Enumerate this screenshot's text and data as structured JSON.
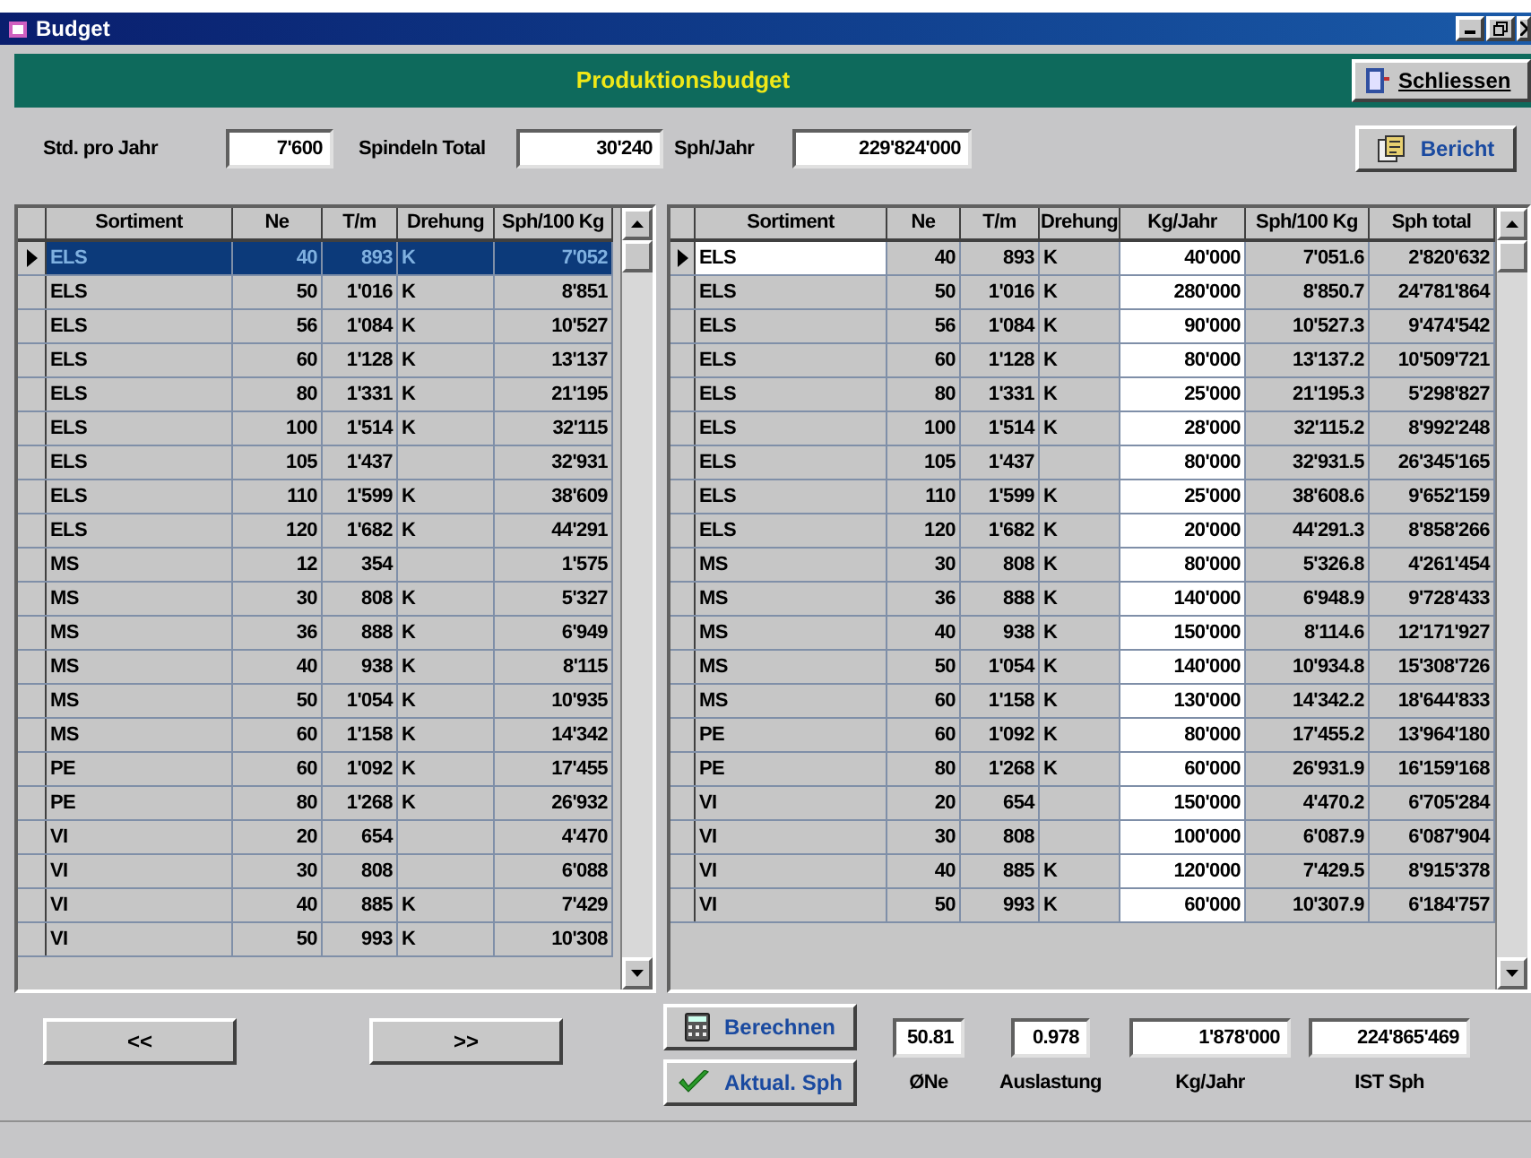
{
  "window": {
    "title": "Budget"
  },
  "header": {
    "title": "Produktionsbudget",
    "close_button": "Schliessen"
  },
  "fields": [
    {
      "label": "Std. pro Jahr",
      "value": "7'600"
    },
    {
      "label": "Spindeln Total",
      "value": "30'240"
    },
    {
      "label": "Sph/Jahr",
      "value": "229'824'000"
    }
  ],
  "report_button": "Bericht",
  "left_table": {
    "kind": "highlight",
    "columns": [
      {
        "label": "Sortiment",
        "kind": "text"
      },
      {
        "label": "Ne",
        "kind": "text"
      },
      {
        "label": "T/m",
        "kind": "text"
      },
      {
        "label": "Drehung",
        "kind": "text"
      },
      {
        "label": "Sph/100 Kg",
        "kind": "text"
      }
    ],
    "rows": [
      {
        "selected": true,
        "cells": [
          "ELS",
          "40",
          "893",
          "K",
          "7'052"
        ]
      },
      {
        "selected": false,
        "cells": [
          "ELS",
          "50",
          "1'016",
          "K",
          "8'851"
        ]
      },
      {
        "selected": false,
        "cells": [
          "ELS",
          "56",
          "1'084",
          "K",
          "10'527"
        ]
      },
      {
        "selected": false,
        "cells": [
          "ELS",
          "60",
          "1'128",
          "K",
          "13'137"
        ]
      },
      {
        "selected": false,
        "cells": [
          "ELS",
          "80",
          "1'331",
          "K",
          "21'195"
        ]
      },
      {
        "selected": false,
        "cells": [
          "ELS",
          "100",
          "1'514",
          "K",
          "32'115"
        ]
      },
      {
        "selected": false,
        "cells": [
          "ELS",
          "105",
          "1'437",
          "",
          "32'931"
        ]
      },
      {
        "selected": false,
        "cells": [
          "ELS",
          "110",
          "1'599",
          "K",
          "38'609"
        ]
      },
      {
        "selected": false,
        "cells": [
          "ELS",
          "120",
          "1'682",
          "K",
          "44'291"
        ]
      },
      {
        "selected": false,
        "cells": [
          "MS",
          "12",
          "354",
          "",
          "1'575"
        ]
      },
      {
        "selected": false,
        "cells": [
          "MS",
          "30",
          "808",
          "K",
          "5'327"
        ]
      },
      {
        "selected": false,
        "cells": [
          "MS",
          "36",
          "888",
          "K",
          "6'949"
        ]
      },
      {
        "selected": false,
        "cells": [
          "MS",
          "40",
          "938",
          "K",
          "8'115"
        ]
      },
      {
        "selected": false,
        "cells": [
          "MS",
          "50",
          "1'054",
          "K",
          "10'935"
        ]
      },
      {
        "selected": false,
        "cells": [
          "MS",
          "60",
          "1'158",
          "K",
          "14'342"
        ]
      },
      {
        "selected": false,
        "cells": [
          "PE",
          "60",
          "1'092",
          "K",
          "17'455"
        ]
      },
      {
        "selected": false,
        "cells": [
          "PE",
          "80",
          "1'268",
          "K",
          "26'932"
        ]
      },
      {
        "selected": false,
        "cells": [
          "VI",
          "20",
          "654",
          "",
          "4'470"
        ]
      },
      {
        "selected": false,
        "cells": [
          "VI",
          "30",
          "808",
          "",
          "6'088"
        ]
      },
      {
        "selected": false,
        "cells": [
          "VI",
          "40",
          "885",
          "K",
          "7'429"
        ]
      },
      {
        "selected": false,
        "cells": [
          "VI",
          "50",
          "993",
          "K",
          "10'308"
        ]
      }
    ]
  },
  "right_table": {
    "kind": "edit",
    "columns": [
      {
        "label": "Sortiment",
        "kind": "text"
      },
      {
        "label": "Ne",
        "kind": "text"
      },
      {
        "label": "T/m",
        "kind": "text"
      },
      {
        "label": "Drehung",
        "kind": "text"
      },
      {
        "label": "Kg/Jahr",
        "kind": "input"
      },
      {
        "label": "Sph/100 Kg",
        "kind": "text"
      },
      {
        "label": "Sph total",
        "kind": "text"
      }
    ],
    "rows": [
      {
        "selected": true,
        "cells": [
          "ELS",
          "40",
          "893",
          "K",
          "40'000",
          "7'051.6",
          "2'820'632"
        ]
      },
      {
        "selected": false,
        "cells": [
          "ELS",
          "50",
          "1'016",
          "K",
          "280'000",
          "8'850.7",
          "24'781'864"
        ]
      },
      {
        "selected": false,
        "cells": [
          "ELS",
          "56",
          "1'084",
          "K",
          "90'000",
          "10'527.3",
          "9'474'542"
        ]
      },
      {
        "selected": false,
        "cells": [
          "ELS",
          "60",
          "1'128",
          "K",
          "80'000",
          "13'137.2",
          "10'509'721"
        ]
      },
      {
        "selected": false,
        "cells": [
          "ELS",
          "80",
          "1'331",
          "K",
          "25'000",
          "21'195.3",
          "5'298'827"
        ]
      },
      {
        "selected": false,
        "cells": [
          "ELS",
          "100",
          "1'514",
          "K",
          "28'000",
          "32'115.2",
          "8'992'248"
        ]
      },
      {
        "selected": false,
        "cells": [
          "ELS",
          "105",
          "1'437",
          "",
          "80'000",
          "32'931.5",
          "26'345'165"
        ]
      },
      {
        "selected": false,
        "cells": [
          "ELS",
          "110",
          "1'599",
          "K",
          "25'000",
          "38'608.6",
          "9'652'159"
        ]
      },
      {
        "selected": false,
        "cells": [
          "ELS",
          "120",
          "1'682",
          "K",
          "20'000",
          "44'291.3",
          "8'858'266"
        ]
      },
      {
        "selected": false,
        "cells": [
          "MS",
          "30",
          "808",
          "K",
          "80'000",
          "5'326.8",
          "4'261'454"
        ]
      },
      {
        "selected": false,
        "cells": [
          "MS",
          "36",
          "888",
          "K",
          "140'000",
          "6'948.9",
          "9'728'433"
        ]
      },
      {
        "selected": false,
        "cells": [
          "MS",
          "40",
          "938",
          "K",
          "150'000",
          "8'114.6",
          "12'171'927"
        ]
      },
      {
        "selected": false,
        "cells": [
          "MS",
          "50",
          "1'054",
          "K",
          "140'000",
          "10'934.8",
          "15'308'726"
        ]
      },
      {
        "selected": false,
        "cells": [
          "MS",
          "60",
          "1'158",
          "K",
          "130'000",
          "14'342.2",
          "18'644'833"
        ]
      },
      {
        "selected": false,
        "cells": [
          "PE",
          "60",
          "1'092",
          "K",
          "80'000",
          "17'455.2",
          "13'964'180"
        ]
      },
      {
        "selected": false,
        "cells": [
          "PE",
          "80",
          "1'268",
          "K",
          "60'000",
          "26'931.9",
          "16'159'168"
        ]
      },
      {
        "selected": false,
        "cells": [
          "VI",
          "20",
          "654",
          "",
          "150'000",
          "4'470.2",
          "6'705'284"
        ]
      },
      {
        "selected": false,
        "cells": [
          "VI",
          "30",
          "808",
          "",
          "100'000",
          "6'087.9",
          "6'087'904"
        ]
      },
      {
        "selected": false,
        "cells": [
          "VI",
          "40",
          "885",
          "K",
          "120'000",
          "7'429.5",
          "8'915'378"
        ]
      },
      {
        "selected": false,
        "cells": [
          "VI",
          "50",
          "993",
          "K",
          "60'000",
          "10'307.9",
          "6'184'757"
        ]
      }
    ]
  },
  "nav_buttons": [
    "<<",
    ">>"
  ],
  "action_buttons": [
    {
      "kind": "calculator",
      "label": "Berechnen"
    },
    {
      "kind": "check",
      "label": "Aktual. Sph"
    }
  ],
  "summary": [
    {
      "value": "50.81",
      "label": "ØNe"
    },
    {
      "value": "0.978",
      "label": "Auslastung"
    },
    {
      "value": "1'878'000",
      "label": "Kg/Jahr"
    },
    {
      "value": "224'865'469",
      "label": "IST Sph"
    }
  ]
}
